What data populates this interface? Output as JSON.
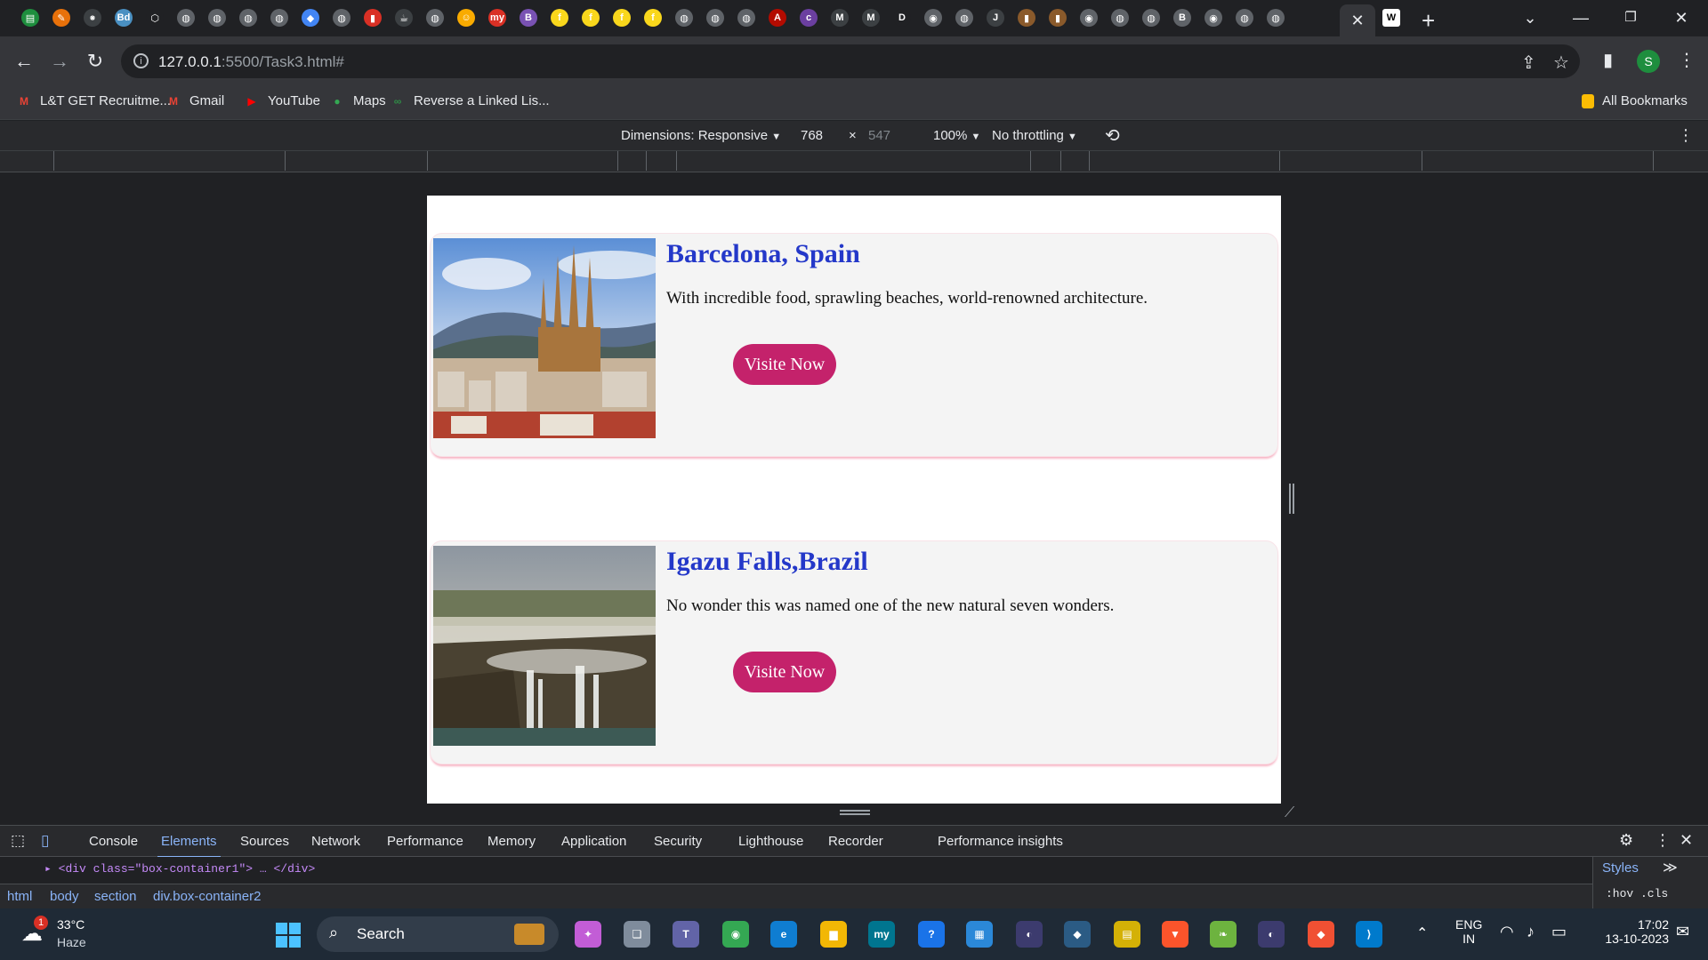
{
  "browser": {
    "tab_close": "✕",
    "new_tab": "+",
    "tab_icons": [
      {
        "name": "sheets-icon",
        "color": "#1e8e3e",
        "glyph": "▤"
      },
      {
        "name": "pencil-icon",
        "color": "#e8710a",
        "glyph": "✎"
      },
      {
        "name": "dark-icon",
        "color": "#3c4043",
        "glyph": "⁕"
      },
      {
        "name": "bd-icon",
        "color": "#4a90c2",
        "glyph": "Bd"
      },
      {
        "name": "codepen-icon",
        "color": "#202124",
        "glyph": "⬡"
      },
      {
        "name": "globe-icon",
        "color": "#5f6368",
        "glyph": "◍"
      },
      {
        "name": "globe-icon",
        "color": "#5f6368",
        "glyph": "◍"
      },
      {
        "name": "globe-icon",
        "color": "#5f6368",
        "glyph": "◍"
      },
      {
        "name": "globe-icon",
        "color": "#5f6368",
        "glyph": "◍"
      },
      {
        "name": "maps-icon",
        "color": "#4285f4",
        "glyph": "◆"
      },
      {
        "name": "globe-icon",
        "color": "#5f6368",
        "glyph": "◍"
      },
      {
        "name": "app-icon",
        "color": "#d93025",
        "glyph": "▮"
      },
      {
        "name": "dark-icon",
        "color": "#3c4043",
        "glyph": "☕"
      },
      {
        "name": "globe-icon",
        "color": "#5f6368",
        "glyph": "◍"
      },
      {
        "name": "smile-icon",
        "color": "#f9ab00",
        "glyph": "☺"
      },
      {
        "name": "myntra-icon",
        "color": "#d93025",
        "glyph": "my"
      },
      {
        "name": "bootstrap-icon",
        "color": "#7952b3",
        "glyph": "B"
      },
      {
        "name": "flipkart-icon",
        "color": "#f9d71c",
        "glyph": "f"
      },
      {
        "name": "flipkart-icon",
        "color": "#f9d71c",
        "glyph": "f"
      },
      {
        "name": "flipkart-icon",
        "color": "#f9d71c",
        "glyph": "f"
      },
      {
        "name": "flipkart-icon",
        "color": "#f9d71c",
        "glyph": "f"
      },
      {
        "name": "globe-icon",
        "color": "#5f6368",
        "glyph": "◍"
      },
      {
        "name": "globe-icon",
        "color": "#5f6368",
        "glyph": "◍"
      },
      {
        "name": "globe-icon",
        "color": "#5f6368",
        "glyph": "◍"
      },
      {
        "name": "adobe-icon",
        "color": "#b30b00",
        "glyph": "A"
      },
      {
        "name": "colorlib-icon",
        "color": "#6b3fa0",
        "glyph": "c"
      },
      {
        "name": "mbc-icon",
        "color": "#3c4043",
        "glyph": "M"
      },
      {
        "name": "mbc-icon",
        "color": "#3c4043",
        "glyph": "M"
      },
      {
        "name": "d-icon",
        "color": "#202124",
        "glyph": "D"
      },
      {
        "name": "chrome-icon",
        "color": "#5f6368",
        "glyph": "◉"
      },
      {
        "name": "globe-icon",
        "color": "#5f6368",
        "glyph": "◍"
      },
      {
        "name": "jae-icon",
        "color": "#3c4043",
        "glyph": "J"
      },
      {
        "name": "book-icon",
        "color": "#8a5a2b",
        "glyph": "▮"
      },
      {
        "name": "book-icon",
        "color": "#8a5a2b",
        "glyph": "▮"
      },
      {
        "name": "chrome-icon",
        "color": "#5f6368",
        "glyph": "◉"
      },
      {
        "name": "globe-icon",
        "color": "#5f6368",
        "glyph": "◍"
      },
      {
        "name": "globe-icon",
        "color": "#5f6368",
        "glyph": "◍"
      },
      {
        "name": "bootstrap-icon",
        "color": "#5f6368",
        "glyph": "B"
      },
      {
        "name": "chrome-icon",
        "color": "#5f6368",
        "glyph": "◉"
      },
      {
        "name": "globe-icon",
        "color": "#5f6368",
        "glyph": "◍"
      },
      {
        "name": "globe-icon",
        "color": "#5f6368",
        "glyph": "◍"
      }
    ],
    "url_host": "127.0.0.1",
    "url_path": ":5500/Task3.html#",
    "profile_letter": "S",
    "bookmarks": [
      {
        "label": "L&T GET Recruitme...",
        "icon": "gmail-icon",
        "color": "#ea4335",
        "glyph": "M"
      },
      {
        "label": "Gmail",
        "icon": "gmail-icon",
        "color": "#ea4335",
        "glyph": "M"
      },
      {
        "label": "YouTube",
        "icon": "youtube-icon",
        "color": "#ff0000",
        "glyph": "▶"
      },
      {
        "label": "Maps",
        "icon": "maps-icon",
        "color": "#34a853",
        "glyph": "●"
      },
      {
        "label": "Reverse a Linked Lis...",
        "icon": "gfg-icon",
        "color": "#2f8d46",
        "glyph": "∞"
      }
    ],
    "all_bookmarks": "All Bookmarks"
  },
  "device_toolbar": {
    "dimensions": "Dimensions: Responsive",
    "width": "768",
    "times": "×",
    "height": "547",
    "zoom": "100%",
    "throttling": "No throttling"
  },
  "page": {
    "cards": [
      {
        "title": "Barcelona, Spain",
        "text": "With incredible food, sprawling beaches, world-renowned architecture.",
        "button": "Visite Now"
      },
      {
        "title": "Igazu Falls,Brazil",
        "text": "No wonder this was named one of the new natural seven wonders.",
        "button": "Visite Now"
      }
    ]
  },
  "devtools": {
    "tabs": [
      "Console",
      "Elements",
      "Sources",
      "Network",
      "Performance",
      "Memory",
      "Application",
      "Security",
      "Lighthouse",
      "Recorder",
      "Performance insights"
    ],
    "active_tab": "Elements",
    "dom_line": "<div class=\"box-container1\"> … </div>",
    "breadcrumbs": [
      "html",
      "body",
      "section",
      "div.box-container2"
    ],
    "styles_tab": "Styles",
    "styles_filter": ":hov .cls"
  },
  "taskbar": {
    "weather_temp": "33°C",
    "weather_desc": "Haze",
    "search": "Search",
    "lang_top": "ENG",
    "lang_bottom": "IN",
    "time": "17:02",
    "date": "13-10-2023",
    "badge": "1"
  }
}
